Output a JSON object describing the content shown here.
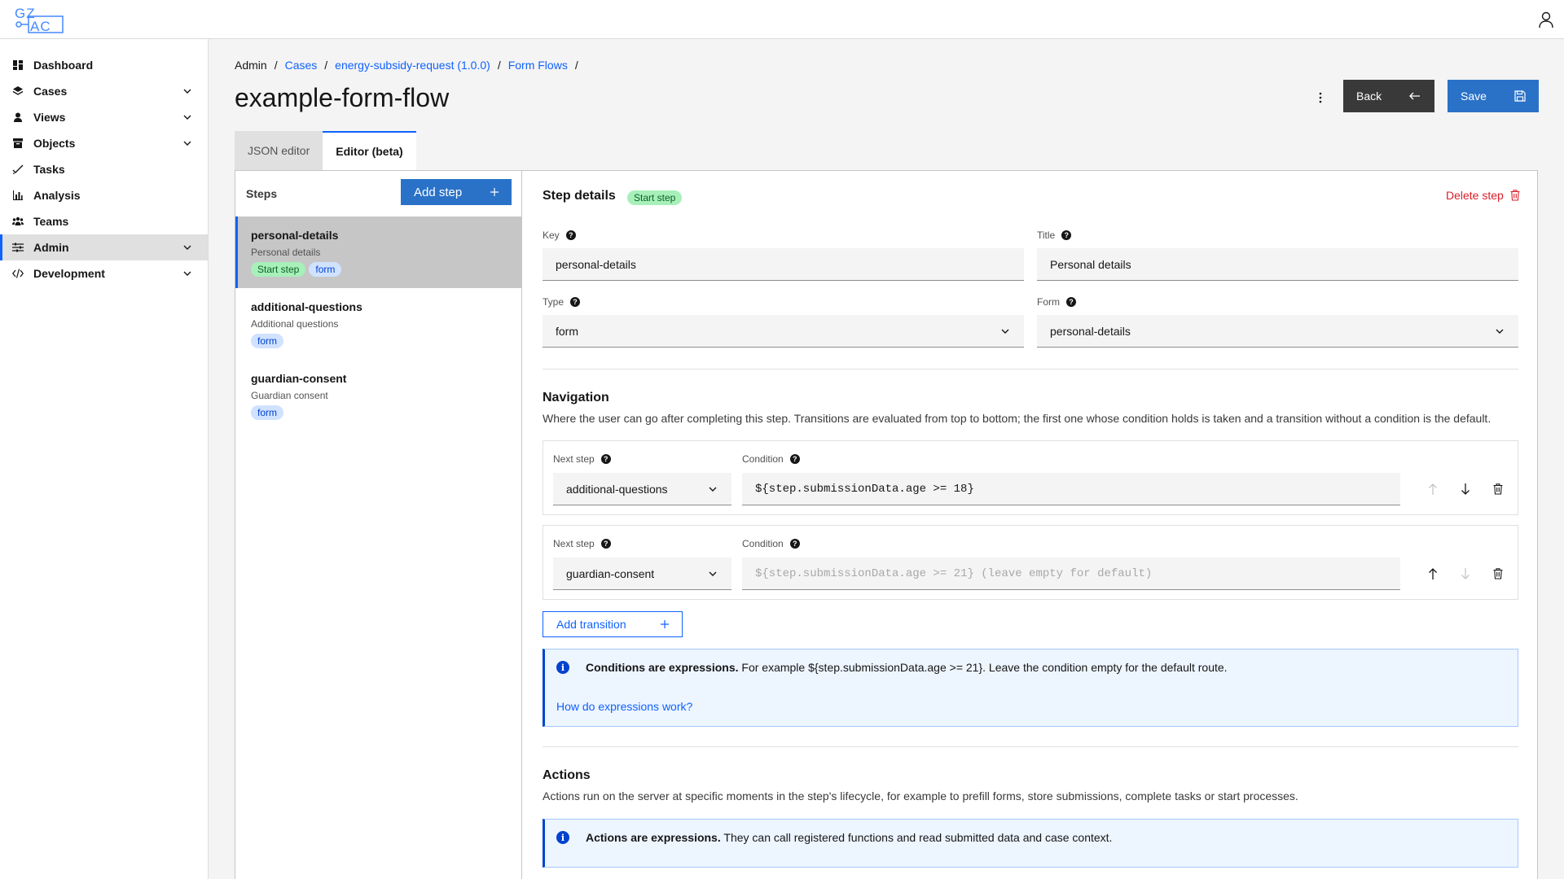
{
  "header": {
    "logo_line1": "GZ",
    "logo_line2": "AC"
  },
  "sidebar": {
    "items": [
      {
        "label": "Dashboard",
        "icon": "dashboard-icon",
        "expandable": false
      },
      {
        "label": "Cases",
        "icon": "layers-icon",
        "expandable": true
      },
      {
        "label": "Views",
        "icon": "user-icon",
        "expandable": true
      },
      {
        "label": "Objects",
        "icon": "archive-icon",
        "expandable": true
      },
      {
        "label": "Tasks",
        "icon": "checkmark-icon",
        "expandable": false
      },
      {
        "label": "Analysis",
        "icon": "chart-icon",
        "expandable": false
      },
      {
        "label": "Teams",
        "icon": "group-icon",
        "expandable": false
      },
      {
        "label": "Admin",
        "icon": "settings-adjust-icon",
        "expandable": true,
        "active": true
      },
      {
        "label": "Development",
        "icon": "code-icon",
        "expandable": true
      }
    ]
  },
  "breadcrumb": {
    "items": [
      "Admin",
      "Cases",
      "energy-subsidy-request (1.0.0)",
      "Form Flows"
    ],
    "separator": "/"
  },
  "page": {
    "title": "example-form-flow",
    "back_label": "Back",
    "save_label": "Save"
  },
  "tabs": [
    {
      "label": "JSON editor",
      "active": false
    },
    {
      "label": "Editor (beta)",
      "active": true
    }
  ],
  "steps_pane": {
    "header": "Steps",
    "add_step_label": "Add step",
    "steps": [
      {
        "key": "personal-details",
        "title": "Personal details",
        "tags": [
          "Start step",
          "form"
        ],
        "selected": true
      },
      {
        "key": "additional-questions",
        "title": "Additional questions",
        "tags": [
          "form"
        ],
        "selected": false
      },
      {
        "key": "guardian-consent",
        "title": "Guardian consent",
        "tags": [
          "form"
        ],
        "selected": false
      }
    ]
  },
  "step_details": {
    "heading": "Step details",
    "start_tag": "Start step",
    "delete_label": "Delete step",
    "key_label": "Key",
    "key_value": "personal-details",
    "title_label": "Title",
    "title_value": "Personal details",
    "type_label": "Type",
    "type_value": "form",
    "form_label": "Form",
    "form_value": "personal-details"
  },
  "navigation": {
    "heading": "Navigation",
    "description": "Where the user can go after completing this step. Transitions are evaluated from top to bottom; the first one whose condition holds is taken and a transition without a condition is the default.",
    "next_step_label": "Next step",
    "condition_label": "Condition",
    "transitions": [
      {
        "next_step": "additional-questions",
        "condition": "${step.submissionData.age >= 18}",
        "placeholder": ""
      },
      {
        "next_step": "guardian-consent",
        "condition": "",
        "placeholder": "${step.submissionData.age >= 21} (leave empty for default)"
      }
    ],
    "add_transition_label": "Add transition",
    "notice_bold": "Conditions are expressions.",
    "notice_text": "For example ${step.submissionData.age >= 21}. Leave the condition empty for the default route.",
    "notice_link": "How do expressions work?"
  },
  "actions": {
    "heading": "Actions",
    "description": "Actions run on the server at specific moments in the step's lifecycle, for example to prefill forms, store submissions, complete tasks or start processes.",
    "notice_bold": "Actions are expressions.",
    "notice_text": "They can call registered functions and read submitted data and case context."
  },
  "colors": {
    "primary": "#0f62fe",
    "danger": "#da1e28",
    "dark_button": "#393939"
  }
}
